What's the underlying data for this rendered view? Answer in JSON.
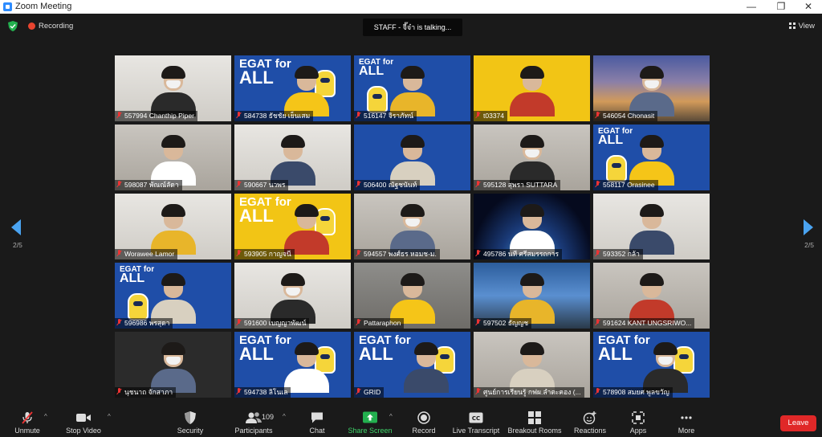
{
  "window": {
    "title": "Zoom Meeting",
    "minimize": "—",
    "maximize": "❐",
    "close": "✕"
  },
  "topbar": {
    "recording_label": "Recording",
    "talking_text": "STAFF - จี๊จ๋า is  talking...",
    "view_label": "View"
  },
  "gallery": {
    "page_left": "2/5",
    "page_right": "2/5",
    "tiles": [
      {
        "name": "557994 Chanthip Piper",
        "bg": "b-white"
      },
      {
        "name": "584738 ธัชชัย เย็นเสม",
        "bg": "b-blue",
        "egat": "large"
      },
      {
        "name": "516147 จิราภัทน์",
        "bg": "b-blue",
        "egat": "small"
      },
      {
        "name": "t03374",
        "bg": "b-yellow"
      },
      {
        "name": "546054 Chonasit",
        "bg": "b-city"
      },
      {
        "name": "598087 พัณณ์ลัดา",
        "bg": "b-room"
      },
      {
        "name": "590667 นวพร",
        "bg": "b-white"
      },
      {
        "name": "506400 ณัฐชนันท์",
        "bg": "b-blue"
      },
      {
        "name": "595128 สุพรา SUTTARA",
        "bg": "b-room"
      },
      {
        "name": "558117 Orasinee",
        "bg": "b-blue",
        "egat": "small"
      },
      {
        "name": "Worawee Lamor",
        "bg": "b-white"
      },
      {
        "name": "593905 กาญจนี",
        "bg": "b-yellow",
        "egat": "large"
      },
      {
        "name": "594557 พงศ์ธร หอมช-ม.",
        "bg": "b-room"
      },
      {
        "name": "495786 นที ศรีสมรรถการ",
        "bg": "b-space"
      },
      {
        "name": "593352 กล้า",
        "bg": "b-white"
      },
      {
        "name": "596986 พรสุดา",
        "bg": "b-blue",
        "egat": "small"
      },
      {
        "name": "591600 เบญญาพัฒน์",
        "bg": "b-white"
      },
      {
        "name": "Pattaraphon",
        "bg": "b-gray"
      },
      {
        "name": "597502 ธัญญช",
        "bg": "b-dusk"
      },
      {
        "name": "591624 KANT UNGSRIWO...",
        "bg": "b-room"
      },
      {
        "name": "นุชนาถ จักสาภา",
        "bg": "b-dark"
      },
      {
        "name": "594738 ลิโนเล",
        "bg": "b-blue",
        "egat": "large"
      },
      {
        "name": "GRID",
        "bg": "b-blue",
        "egat": "large"
      },
      {
        "name": "ศูนย์การเรียนรู้ กฟผ.ลำตะคอง (...",
        "bg": "b-room"
      },
      {
        "name": "578908 สมยศ พูลขวัญ",
        "bg": "b-blue",
        "egat": "large"
      }
    ],
    "egat_text_1": "EGAT for",
    "egat_text_2": "ALL"
  },
  "toolbar": {
    "unmute": "Unmute",
    "stop_video": "Stop Video",
    "security": "Security",
    "participants": "Participants",
    "participant_count": "109",
    "chat": "Chat",
    "share_screen": "Share Screen",
    "record": "Record",
    "live_transcript": "Live Transcript",
    "breakout_rooms": "Breakout Rooms",
    "reactions": "Reactions",
    "apps": "Apps",
    "more": "More",
    "leave": "Leave"
  },
  "colors": {
    "accent": "#2d8cff",
    "share_green": "#23b04f",
    "leave_red": "#e02828",
    "muted_red": "#e33333"
  }
}
